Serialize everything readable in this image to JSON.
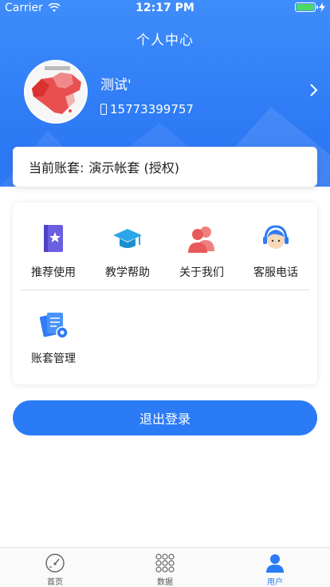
{
  "status_bar": {
    "carrier": "Carrier",
    "time": "12:17 PM"
  },
  "header": {
    "title": "个人中心"
  },
  "profile": {
    "name": "测试'",
    "phone": "15773399757"
  },
  "account": {
    "label": "当前账套:",
    "value": "演示帐套 (授权)"
  },
  "grid": {
    "items": [
      {
        "label": "推荐使用",
        "icon": "bookmark-book-icon"
      },
      {
        "label": "教学帮助",
        "icon": "graduation-cap-icon"
      },
      {
        "label": "关于我们",
        "icon": "users-icon"
      },
      {
        "label": "客服电话",
        "icon": "customer-service-icon"
      },
      {
        "label": "账套管理",
        "icon": "documents-settings-icon"
      }
    ]
  },
  "logout_label": "退出登录",
  "tabs": [
    {
      "label": "首页",
      "icon": "speedometer-icon",
      "active": false
    },
    {
      "label": "数据",
      "icon": "dots-grid-icon",
      "active": false
    },
    {
      "label": "用户",
      "icon": "user-icon",
      "active": true
    }
  ],
  "colors": {
    "primary": "#2a7bf5",
    "header": "#3f8dfb"
  }
}
